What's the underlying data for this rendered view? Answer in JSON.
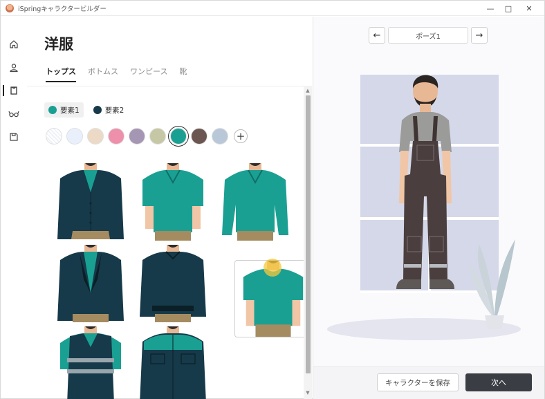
{
  "window": {
    "title": "iSpringキャラクタービルダー",
    "icons": {
      "app": "app-logo-icon",
      "minimize": "minimize-icon",
      "maximize": "maximize-icon",
      "close": "close-icon"
    }
  },
  "nav": {
    "items": [
      {
        "icon": "home-icon"
      },
      {
        "icon": "person-icon"
      },
      {
        "icon": "shirt-icon",
        "active": true
      },
      {
        "icon": "glasses-icon"
      },
      {
        "icon": "save-icon"
      }
    ]
  },
  "page": {
    "title": "洋服",
    "tabs": [
      {
        "label": "トップス",
        "active": true
      },
      {
        "label": "ボトムス"
      },
      {
        "label": "ワンピース"
      },
      {
        "label": "靴"
      }
    ],
    "elements": [
      {
        "label": "要素1",
        "color": "#1aa093",
        "active": true
      },
      {
        "label": "要素2",
        "color": "#163a4a"
      }
    ],
    "swatches": [
      {
        "color": "#ffffff",
        "pattern": true
      },
      {
        "color": "#e9f0fb"
      },
      {
        "color": "#ecdac7"
      },
      {
        "color": "#ee8fab"
      },
      {
        "color": "#a596b3"
      },
      {
        "color": "#c6c7a5"
      },
      {
        "color": "#1aa093",
        "selected": true
      },
      {
        "color": "#6b5651"
      },
      {
        "color": "#b9c8d8"
      }
    ],
    "add_swatch_label": "+"
  },
  "clothing_items": [
    {
      "name": "cardigan",
      "main": "#163a4a",
      "shirt": "#1aa093"
    },
    {
      "name": "polo-shirt",
      "main": "#1aa093"
    },
    {
      "name": "polo-long-sleeve",
      "main": "#1aa093"
    },
    {
      "name": "blazer",
      "main": "#163a4a",
      "shirt": "#1aa093"
    },
    {
      "name": "sweater",
      "main": "#163a4a"
    },
    {
      "name": "t-shirt",
      "main": "#1aa093",
      "selected": true
    },
    {
      "name": "safety-vest",
      "main": "#163a4a",
      "shirt": "#1aa093"
    },
    {
      "name": "work-jacket",
      "main": "#163a4a",
      "shirt": "#1aa093"
    }
  ],
  "preview": {
    "pose_label": "ポーズ1",
    "prev_icon": "arrow-left-icon",
    "next_icon": "arrow-right-icon"
  },
  "footer": {
    "save_label": "キャラクターを保存",
    "next_label": "次へ"
  }
}
